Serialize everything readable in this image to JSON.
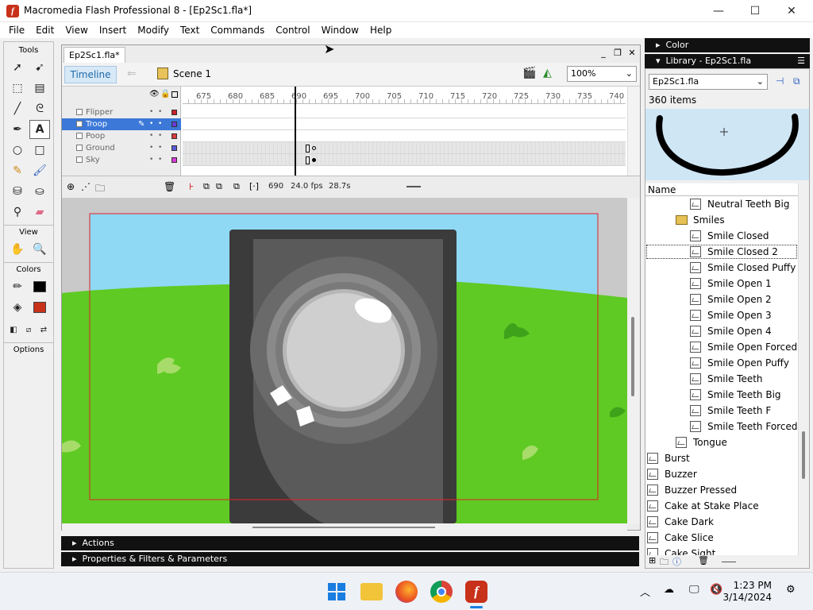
{
  "window": {
    "title": "Macromedia Flash Professional 8 - [Ep2Sc1.fla*]",
    "logo_letter": "f",
    "minimize": "—",
    "maximize": "☐",
    "close": "✕"
  },
  "menu": [
    "File",
    "Edit",
    "View",
    "Insert",
    "Modify",
    "Text",
    "Commands",
    "Control",
    "Window",
    "Help"
  ],
  "tools": {
    "title": "Tools",
    "view_title": "View",
    "colors_title": "Colors",
    "options_title": "Options"
  },
  "document": {
    "tab": "Ep2Sc1.fla*",
    "timeline_label": "Timeline",
    "scene_label": "Scene 1",
    "zoom": "100%"
  },
  "timeline": {
    "layers": [
      {
        "name": "Flipper",
        "color": "#c8202a"
      },
      {
        "name": "Troop",
        "color": "#6a3bd8",
        "selected": true
      },
      {
        "name": "Poop",
        "color": "#d83b3b"
      },
      {
        "name": "Ground",
        "color": "#5a5ad8"
      },
      {
        "name": "Sky",
        "color": "#d83bd8"
      }
    ],
    "ticks": [
      "675",
      "680",
      "685",
      "690",
      "695",
      "700",
      "705",
      "710",
      "715",
      "720",
      "725",
      "730",
      "735",
      "740"
    ],
    "current_frame": "690",
    "fps": "24.0 fps",
    "time": "28.7s"
  },
  "panels": {
    "actions": "Actions",
    "properties": "Properties & Filters & Parameters",
    "color": "Color",
    "library": "Library - Ep2Sc1.fla"
  },
  "library": {
    "file": "Ep2Sc1.fla",
    "count": "360 items",
    "column_name": "Name",
    "items": [
      {
        "label": "Neutral Teeth Big",
        "indent": 2,
        "type": "symbol"
      },
      {
        "label": "Smiles",
        "indent": 1,
        "type": "folder"
      },
      {
        "label": "Smile Closed",
        "indent": 2,
        "type": "symbol"
      },
      {
        "label": "Smile Closed 2",
        "indent": 2,
        "type": "symbol",
        "selected": true
      },
      {
        "label": "Smile Closed Puffy",
        "indent": 2,
        "type": "symbol"
      },
      {
        "label": "Smile Open 1",
        "indent": 2,
        "type": "symbol"
      },
      {
        "label": "Smile Open 2",
        "indent": 2,
        "type": "symbol"
      },
      {
        "label": "Smile Open 3",
        "indent": 2,
        "type": "symbol"
      },
      {
        "label": "Smile Open 4",
        "indent": 2,
        "type": "symbol"
      },
      {
        "label": "Smile Open Forced",
        "indent": 2,
        "type": "symbol"
      },
      {
        "label": "Smile Open Puffy",
        "indent": 2,
        "type": "symbol"
      },
      {
        "label": "Smile Teeth",
        "indent": 2,
        "type": "symbol"
      },
      {
        "label": "Smile Teeth Big",
        "indent": 2,
        "type": "symbol"
      },
      {
        "label": "Smile Teeth F",
        "indent": 2,
        "type": "symbol"
      },
      {
        "label": "Smile Teeth Forced",
        "indent": 2,
        "type": "symbol"
      },
      {
        "label": "Tongue",
        "indent": 1,
        "type": "symbol"
      },
      {
        "label": "Burst",
        "indent": 0,
        "type": "symbol"
      },
      {
        "label": "Buzzer",
        "indent": 0,
        "type": "symbol"
      },
      {
        "label": "Buzzer Pressed",
        "indent": 0,
        "type": "symbol"
      },
      {
        "label": "Cake at Stake Place",
        "indent": 0,
        "type": "symbol"
      },
      {
        "label": "Cake Dark",
        "indent": 0,
        "type": "symbol"
      },
      {
        "label": "Cake Slice",
        "indent": 0,
        "type": "symbol"
      },
      {
        "label": "Cake Sight",
        "indent": 0,
        "type": "symbol"
      }
    ]
  },
  "taskbar": {
    "time": "1:23 PM",
    "date": "3/14/2024"
  },
  "colors": {
    "sky": "#8fd9f5",
    "grass": "#5fca23",
    "accent_red": "#c8311a"
  }
}
